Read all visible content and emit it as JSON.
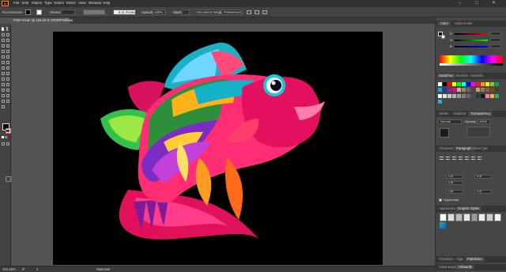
{
  "menubar": {
    "app_logo": "Ai",
    "items": [
      "File",
      "Edit",
      "Object",
      "Type",
      "Select",
      "Effect",
      "View",
      "Window",
      "Help"
    ]
  },
  "control_bar": {
    "selection_label": "No Selection",
    "stroke_label": "Stroke:",
    "stroke_profile": "5 pt. Round",
    "opacity_label": "Opacity:",
    "opacity_value": "100%",
    "style_label": "Style:",
    "document_setup": "Document Setup",
    "preferences": "Preferences"
  },
  "document_tab": {
    "title": "FISH Art.ai* @ 104.16 % (RGB/Preview)"
  },
  "status_bar": {
    "zoom": "104.16%",
    "angle": "0°",
    "artboard_num": "1",
    "tool_name": "Selection"
  },
  "panels": {
    "color": {
      "tabs": [
        "Color",
        "Color Guide"
      ],
      "channels": [
        "R",
        "G",
        "B"
      ]
    },
    "swatches": {
      "tabs": [
        "Swatches",
        "Brushes",
        "Symbols"
      ]
    },
    "stroke_group": {
      "tabs": [
        "Stroke",
        "Gradient",
        "Transparency"
      ],
      "blend_mode": "Normal",
      "opacity_label": "Opacity:",
      "opacity_value": "100%"
    },
    "character": {
      "tabs": [
        "Character",
        "Paragraph",
        "OpenType"
      ],
      "fields": [
        "0 pt",
        "0 pt",
        "0 pt",
        "0 pt",
        "0 pt"
      ],
      "hyphenate": "Hyphenate"
    },
    "appearance": {
      "tabs": [
        "Appearance",
        "Graphic Styles"
      ]
    },
    "bottom": {
      "tabs": [
        "Transform",
        "Align",
        "Pathfinder"
      ],
      "tabs2": [
        "Asset Export",
        "Artboards"
      ]
    }
  },
  "colors": {
    "accent": "#ff9a00",
    "fill": "#000000",
    "canvas": "#000000"
  },
  "swatches": [
    "#ffffff",
    "#000000",
    "#ff0000",
    "#ffff00",
    "#00ff00",
    "#00ffff",
    "#0000ff",
    "#ff00ff",
    "#ed1c24",
    "#f7941d",
    "#fff200",
    "#8dc63f",
    "#00a651",
    "#00aeef",
    "#2e3192",
    "#92278f",
    "#ec008c",
    "#c2b59b",
    "#998675",
    "#736357",
    "#534741",
    "#c69c6d",
    "#a67c52",
    "#8c6239",
    "#754c24",
    "#603913",
    "#ffffff",
    "#e6e6e6",
    "#cccccc",
    "#b3b3b3",
    "#999999",
    "#808080",
    "#666666",
    "#4d4d4d",
    "#333333",
    "#1a1a1a",
    "#ff7bac",
    "#fbb03b",
    "#22b573",
    "#29abe2"
  ]
}
